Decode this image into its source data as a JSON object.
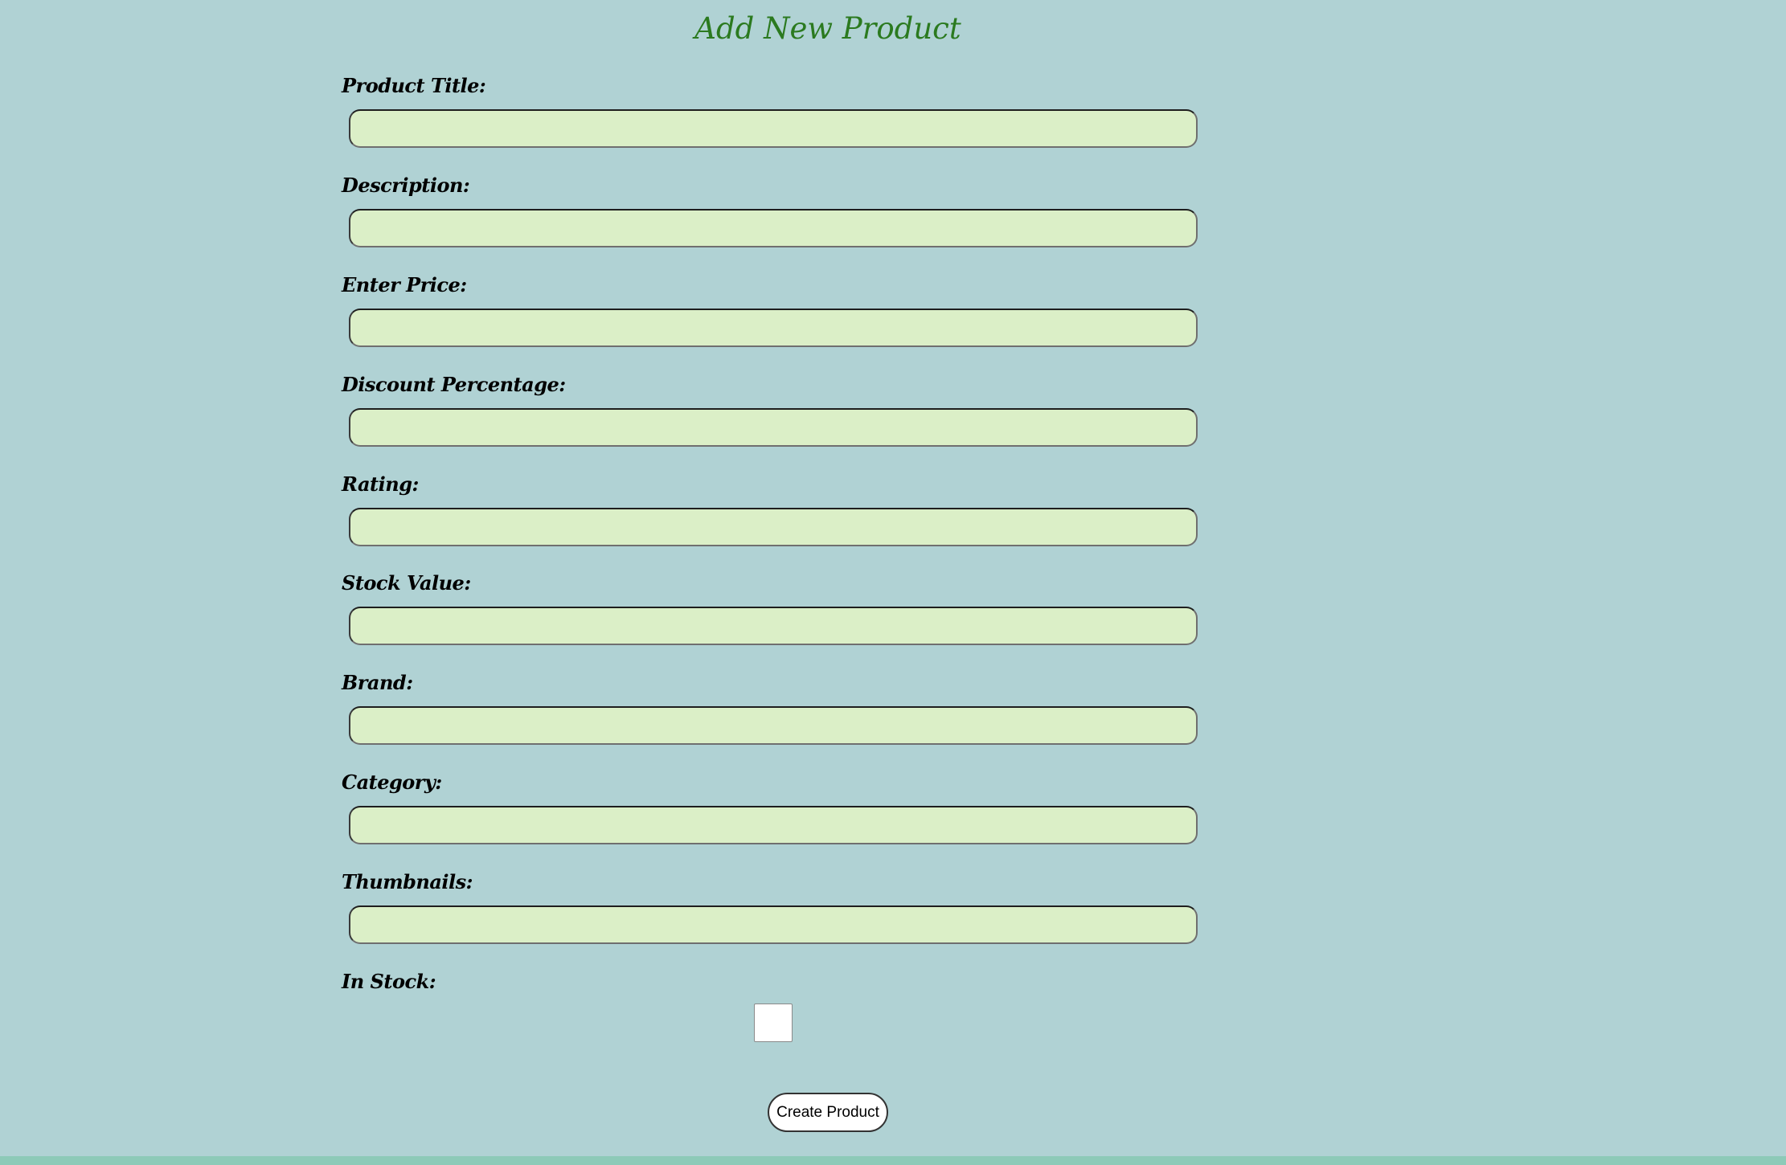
{
  "page": {
    "title": "Add New Product"
  },
  "form": {
    "fields": [
      {
        "label": "Product Title:",
        "value": "",
        "placeholder": ""
      },
      {
        "label": "Description:",
        "value": "",
        "placeholder": ""
      },
      {
        "label": "Enter Price:",
        "value": "",
        "placeholder": ""
      },
      {
        "label": "Discount Percentage:",
        "value": "",
        "placeholder": ""
      },
      {
        "label": "Rating:",
        "value": "",
        "placeholder": ""
      },
      {
        "label": "Stock Value:",
        "value": "",
        "placeholder": ""
      },
      {
        "label": "Brand:",
        "value": "",
        "placeholder": ""
      },
      {
        "label": "Category:",
        "value": "",
        "placeholder": ""
      },
      {
        "label": "Thumbnails:",
        "value": "",
        "placeholder": ""
      }
    ],
    "in_stock": {
      "label": "In Stock:",
      "checked": false
    },
    "submit_label": "Create Product"
  },
  "colors": {
    "background": "#b0d2d4",
    "title": "#2b7a1f",
    "input_fill": "#dbefc7",
    "footer_bar": "#8dcab8"
  }
}
